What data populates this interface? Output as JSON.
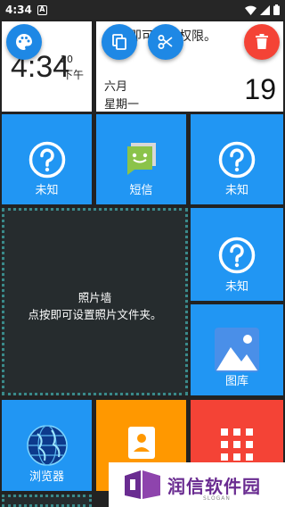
{
  "status_bar": {
    "time": "4:34",
    "a_badge": "A"
  },
  "clock_tile": {
    "time": "4:34",
    "seconds": "20",
    "ampm": "下午"
  },
  "calendar_tile": {
    "text": "点按即可授予权限。",
    "month": "六月",
    "weekday": "星期一",
    "day": "19"
  },
  "tiles": {
    "unknown_1": {
      "label": "未知"
    },
    "sms": {
      "label": "短信"
    },
    "unknown_2": {
      "label": "未知"
    },
    "unknown_3": {
      "label": "未知"
    },
    "gallery": {
      "label": "图库"
    },
    "browser": {
      "label": "浏览器"
    }
  },
  "photo_wall": {
    "title": "照片墙",
    "hint": "点按即可设置照片文件夹。"
  },
  "watermark": {
    "brand": "润信软件园",
    "slogan": "SLOGAN"
  },
  "colors": {
    "tile_blue": "#2196F3",
    "orange": "#FF9800",
    "red": "#F44336",
    "background": "#222222"
  }
}
